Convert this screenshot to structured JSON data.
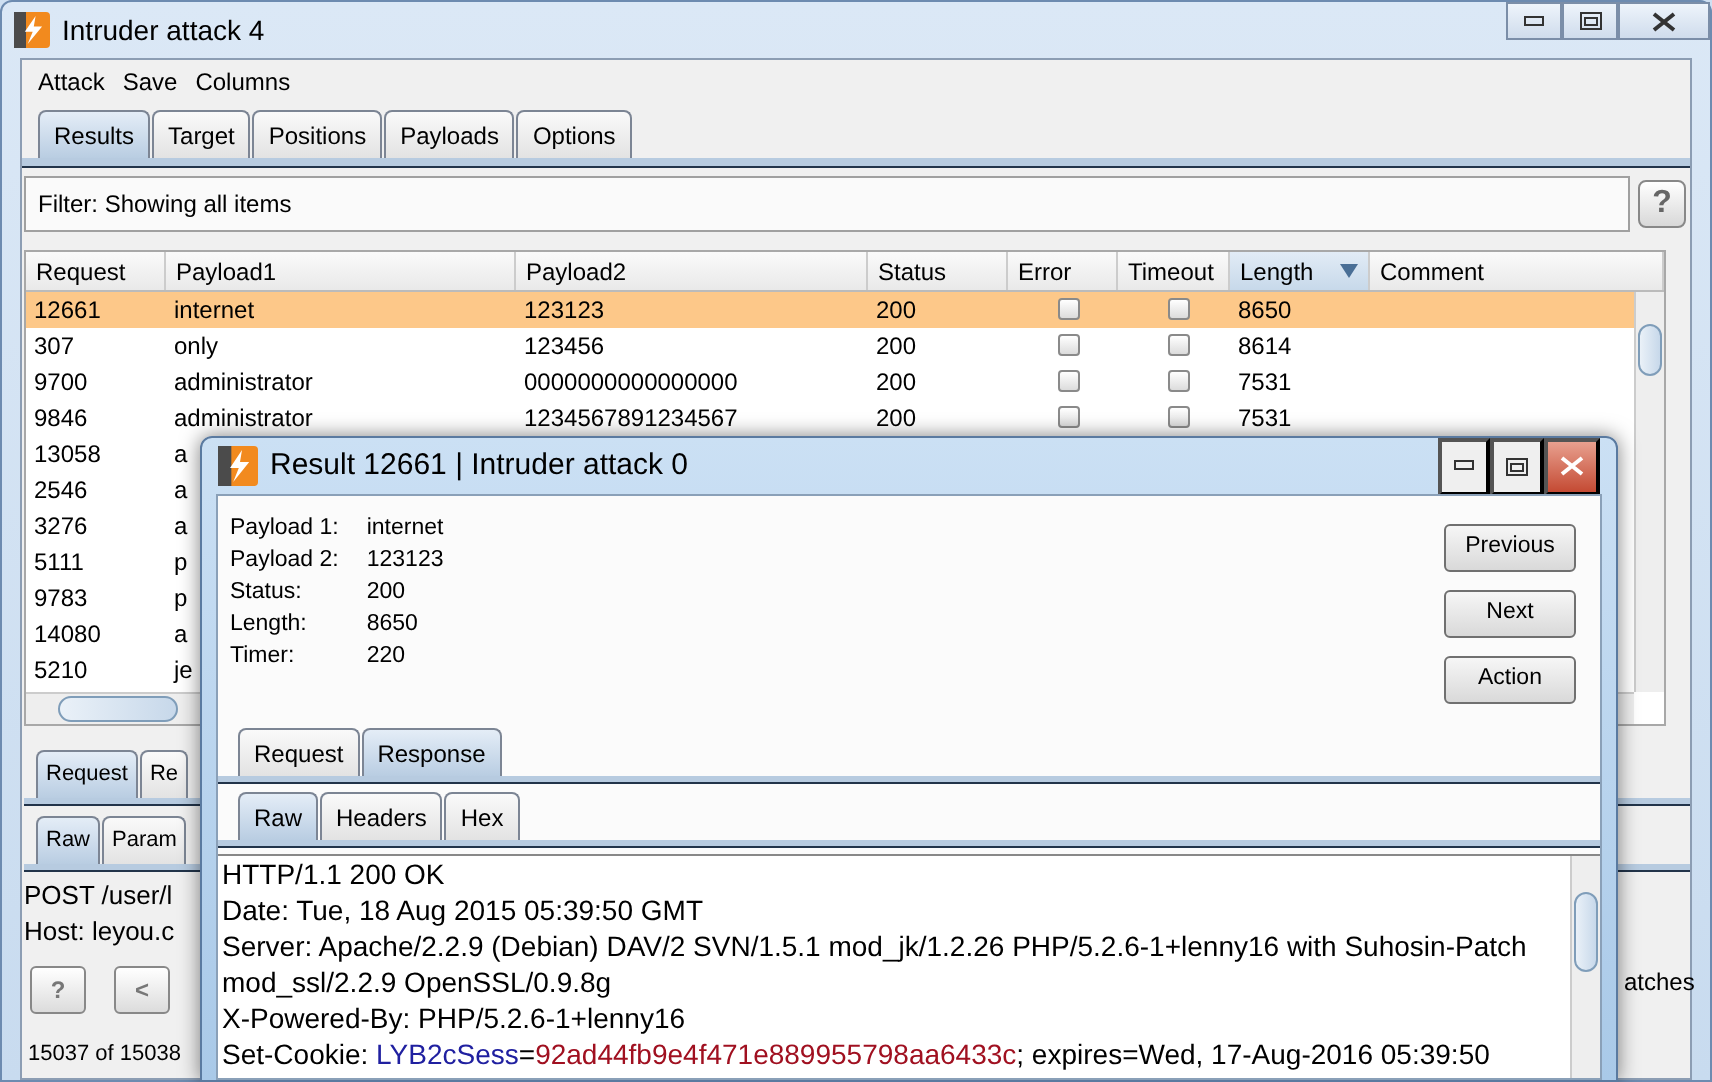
{
  "window": {
    "title": "Intruder attack 4"
  },
  "menu": [
    "Attack",
    "Save",
    "Columns"
  ],
  "tabs": [
    {
      "label": "Results",
      "selected": true
    },
    {
      "label": "Target",
      "selected": false
    },
    {
      "label": "Positions",
      "selected": false
    },
    {
      "label": "Payloads",
      "selected": false
    },
    {
      "label": "Options",
      "selected": false
    }
  ],
  "filter": {
    "text": "Filter:  Showing all items",
    "help": "?"
  },
  "table": {
    "columns": [
      {
        "label": "Request",
        "sorted": false
      },
      {
        "label": "Payload1",
        "sorted": false
      },
      {
        "label": "Payload2",
        "sorted": false
      },
      {
        "label": "Status",
        "sorted": false
      },
      {
        "label": "Error",
        "sorted": false
      },
      {
        "label": "Timeout",
        "sorted": false
      },
      {
        "label": "Length",
        "sorted": true
      },
      {
        "label": "Comment",
        "sorted": false
      }
    ],
    "rows": [
      {
        "request": "12661",
        "payload1": "internet",
        "payload2": "123123",
        "status": "200",
        "error": false,
        "timeout": false,
        "length": "8650",
        "selected": true
      },
      {
        "request": "307",
        "payload1": "only",
        "payload2": "123456",
        "status": "200",
        "error": false,
        "timeout": false,
        "length": "8614",
        "selected": false
      },
      {
        "request": "9700",
        "payload1": "administrator",
        "payload2": "0000000000000000",
        "status": "200",
        "error": false,
        "timeout": false,
        "length": "7531",
        "selected": false
      },
      {
        "request": "9846",
        "payload1": "administrator",
        "payload2": "1234567891234567",
        "status": "200",
        "error": false,
        "timeout": false,
        "length": "7531",
        "selected": false
      },
      {
        "request": "13058",
        "payload1": "a",
        "selected": false
      },
      {
        "request": "2546",
        "payload1": "a",
        "selected": false
      },
      {
        "request": "3276",
        "payload1": "a",
        "selected": false
      },
      {
        "request": "5111",
        "payload1": "p",
        "selected": false
      },
      {
        "request": "9783",
        "payload1": "p",
        "selected": false
      },
      {
        "request": "14080",
        "payload1": "a",
        "selected": false
      },
      {
        "request": "5210",
        "payload1": "je",
        "selected": false
      }
    ]
  },
  "request_tabs": [
    {
      "label": "Request",
      "selected": true
    },
    {
      "label": "Re",
      "selected": false
    }
  ],
  "request_view_tabs": [
    {
      "label": "Raw",
      "selected": true
    },
    {
      "label": "Param",
      "selected": false
    }
  ],
  "request_lines": [
    "POST /user/l",
    "Host: leyou.c"
  ],
  "nav_buttons": [
    "?",
    "<"
  ],
  "matches_label": "atches",
  "status": "15037 of 15038",
  "dialog": {
    "title": "Result 12661 | Intruder attack 0",
    "fields": [
      {
        "label": "Payload 1:",
        "value": "internet"
      },
      {
        "label": "Payload 2:",
        "value": "123123"
      },
      {
        "label": "Status:",
        "value": "200"
      },
      {
        "label": "Length:",
        "value": "8650"
      },
      {
        "label": "Timer:",
        "value": "220"
      }
    ],
    "buttons": [
      "Previous",
      "Next",
      "Action"
    ],
    "tabs": [
      {
        "label": "Request",
        "selected": false
      },
      {
        "label": "Response",
        "selected": true
      }
    ],
    "view_tabs": [
      {
        "label": "Raw",
        "selected": true
      },
      {
        "label": "Headers",
        "selected": false
      },
      {
        "label": "Hex",
        "selected": false
      }
    ],
    "lines": [
      [
        {
          "kind": "plain",
          "text": "HTTP/1.1 200 OK"
        }
      ],
      [
        {
          "kind": "plain",
          "text": "Date: Tue, 18 Aug 2015 05:39:50 GMT"
        }
      ],
      [
        {
          "kind": "plain",
          "text": "Server: Apache/2.2.9 (Debian) DAV/2 SVN/1.5.1 mod_jk/1.2.26 PHP/5.2.6-1+lenny16 with Suhosin-Patch"
        }
      ],
      [
        {
          "kind": "plain",
          "text": "mod_ssl/2.2.9 OpenSSL/0.9.8g"
        }
      ],
      [
        {
          "kind": "plain",
          "text": "X-Powered-By: PHP/5.2.6-1+lenny16"
        }
      ],
      [
        {
          "kind": "plain",
          "text": "Set-Cookie: "
        },
        {
          "kind": "name",
          "text": "LYB2cSess"
        },
        {
          "kind": "plain",
          "text": "="
        },
        {
          "kind": "value",
          "text": "92ad44fb9e4f471e889955798aa6433c"
        },
        {
          "kind": "plain",
          "text": "; expires=Wed, 17-Aug-2016 05:39:50"
        }
      ]
    ]
  }
}
